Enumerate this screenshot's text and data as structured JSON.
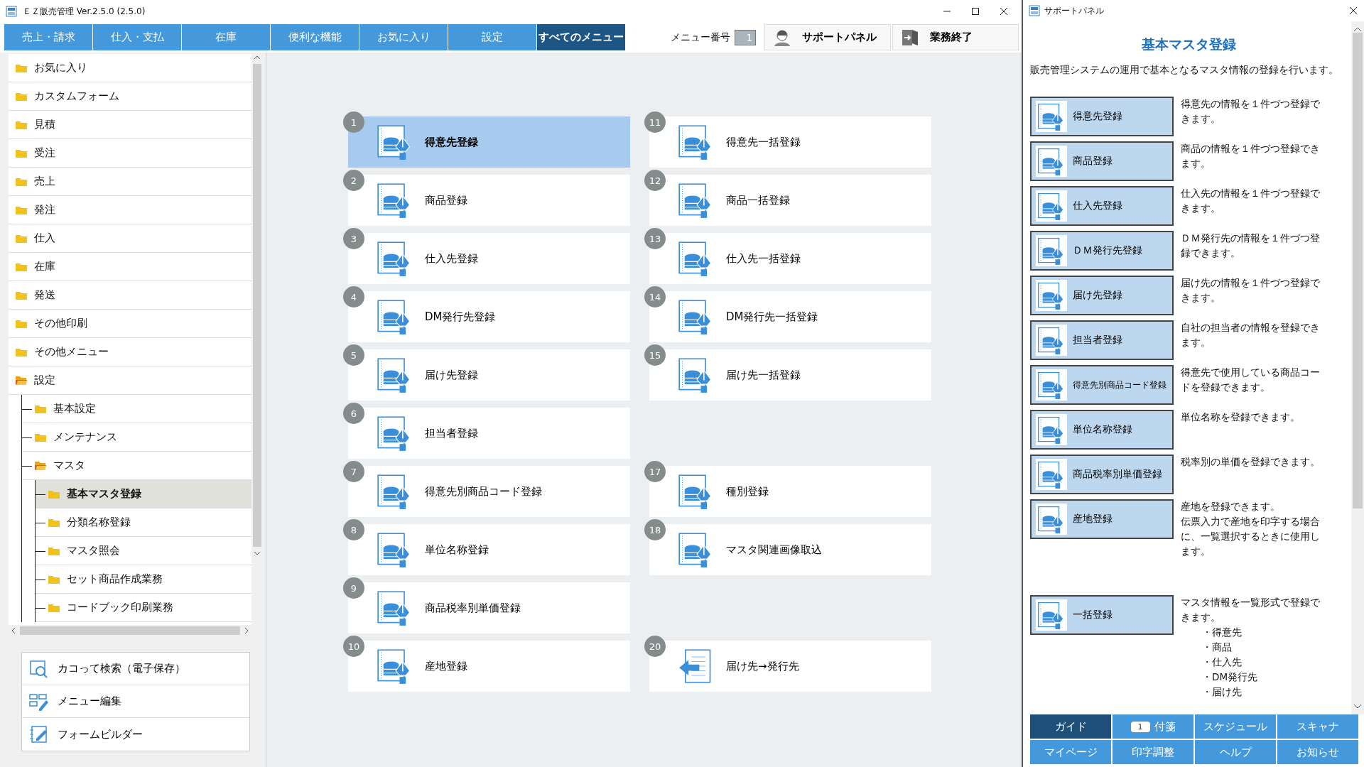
{
  "window": {
    "title": "ＥＺ販売管理 Ver.2.5.0 (2.5.0)"
  },
  "menu_tabs": [
    {
      "label": "売上・請求",
      "selected": false
    },
    {
      "label": "仕入・支払",
      "selected": false
    },
    {
      "label": "在庫",
      "selected": false
    },
    {
      "label": "便利な機能",
      "selected": false
    },
    {
      "label": "お気に入り",
      "selected": false
    },
    {
      "label": "設定",
      "selected": false
    },
    {
      "label": "すべてのメニュー",
      "selected": true
    }
  ],
  "menu_number": {
    "label": "メニュー番号",
    "value": "1"
  },
  "toolbar_buttons": [
    {
      "label": "サポートパネル",
      "kind": "support"
    },
    {
      "label": "業務終了",
      "kind": "exit"
    }
  ],
  "tree": [
    {
      "label": "お気に入り",
      "expanded": false,
      "selected": false
    },
    {
      "label": "カスタムフォーム",
      "expanded": false,
      "selected": false
    },
    {
      "label": "見積",
      "expanded": false,
      "selected": false
    },
    {
      "label": "受注",
      "expanded": false,
      "selected": false
    },
    {
      "label": "売上",
      "expanded": false,
      "selected": false
    },
    {
      "label": "発注",
      "expanded": false,
      "selected": false
    },
    {
      "label": "仕入",
      "expanded": false,
      "selected": false
    },
    {
      "label": "在庫",
      "expanded": false,
      "selected": false
    },
    {
      "label": "発送",
      "expanded": false,
      "selected": false
    },
    {
      "label": "その他印刷",
      "expanded": false,
      "selected": false
    },
    {
      "label": "その他メニュー",
      "expanded": false,
      "selected": false
    },
    {
      "label": "設定",
      "expanded": true,
      "selected": false,
      "children": [
        {
          "label": "基本設定",
          "expanded": false,
          "selected": false
        },
        {
          "label": "メンテナンス",
          "expanded": false,
          "selected": false
        },
        {
          "label": "マスタ",
          "expanded": true,
          "selected": false,
          "children": [
            {
              "label": "基本マスタ登録",
              "expanded": false,
              "selected": true
            },
            {
              "label": "分類名称登録",
              "expanded": false,
              "selected": false
            },
            {
              "label": "マスタ照会",
              "expanded": false,
              "selected": false
            },
            {
              "label": "セット商品作成業務",
              "expanded": false,
              "selected": false
            },
            {
              "label": "コードブック印刷業務",
              "expanded": false,
              "selected": false
            }
          ]
        }
      ]
    }
  ],
  "sidebar_buttons": [
    {
      "label": "カコって検索（電子保存）",
      "kind": "search"
    },
    {
      "label": "メニュー編集",
      "kind": "edit"
    },
    {
      "label": "フォームビルダー",
      "kind": "form"
    }
  ],
  "tiles_left": [
    {
      "number": "1",
      "label": "得意先登録",
      "kind": "master",
      "selected": true
    },
    {
      "number": "2",
      "label": "商品登録",
      "kind": "master",
      "selected": false
    },
    {
      "number": "3",
      "label": "仕入先登録",
      "kind": "master",
      "selected": false
    },
    {
      "number": "4",
      "label": "DM発行先登録",
      "kind": "master",
      "selected": false
    },
    {
      "number": "5",
      "label": "届け先登録",
      "kind": "master",
      "selected": false
    },
    {
      "number": "6",
      "label": "担当者登録",
      "kind": "master",
      "selected": false
    },
    {
      "number": "7",
      "label": "得意先別商品コード登録",
      "kind": "master",
      "selected": false
    },
    {
      "number": "8",
      "label": "単位名称登録",
      "kind": "master",
      "selected": false
    },
    {
      "number": "9",
      "label": "商品税率別単価登録",
      "kind": "master",
      "selected": false
    },
    {
      "number": "10",
      "label": "産地登録",
      "kind": "master",
      "selected": false
    }
  ],
  "tiles_right": [
    {
      "number": "11",
      "label": "得意先一括登録",
      "kind": "master",
      "selected": false
    },
    {
      "number": "12",
      "label": "商品一括登録",
      "kind": "master",
      "selected": false
    },
    {
      "number": "13",
      "label": "仕入先一括登録",
      "kind": "master",
      "selected": false
    },
    {
      "number": "14",
      "label": "DM発行先一括登録",
      "kind": "master",
      "selected": false
    },
    {
      "number": "15",
      "label": "届け先一括登録",
      "kind": "master",
      "selected": false
    },
    {
      "kind": "blank"
    },
    {
      "number": "17",
      "label": "種別登録",
      "kind": "master",
      "selected": false
    },
    {
      "number": "18",
      "label": "マスタ関連画像取込",
      "kind": "master",
      "selected": false
    },
    {
      "kind": "blank"
    },
    {
      "number": "20",
      "label": "届け先→発行先",
      "kind": "transfer",
      "selected": false
    }
  ],
  "support_panel": {
    "title": "サポートパネル",
    "heading": "基本マスタ登録",
    "description": "販売管理システムの運用で基本となるマスタ情報の登録を行います。",
    "items": [
      {
        "label": "得意先登録",
        "lines": [
          "得意先の情報を１件づつ登録できます。"
        ]
      },
      {
        "label": "商品登録",
        "lines": [
          "商品の情報を１件づつ登録できます。"
        ]
      },
      {
        "label": "仕入先登録",
        "lines": [
          "仕入先の情報を１件づつ登録できます。"
        ]
      },
      {
        "label": "ＤＭ発行先登録",
        "lines": [
          "ＤＭ発行先の情報を１件づつ登録できます。"
        ]
      },
      {
        "label": "届け先登録",
        "lines": [
          "届け先の情報を１件づつ登録できます。"
        ]
      },
      {
        "label": "担当者登録",
        "lines": [
          "自社の担当者の情報を登録できます。"
        ]
      },
      {
        "label": "得意先別商品コード登録",
        "lines": [
          "得意先で使用している商品コードを登録できます。"
        ]
      },
      {
        "label": "単位名称登録",
        "lines": [
          "単位名称を登録できます。"
        ]
      },
      {
        "label": "商品税率別単価登録",
        "lines": [
          "税率別の単価を登録できます。"
        ]
      },
      {
        "label": "産地登録",
        "lines": [
          "産地を登録できます。",
          "伝票入力で産地を印字する場合に、一覧選択するときに使用します。"
        ]
      },
      {
        "label": "一括登録",
        "lines": [
          "マスタ情報を一覧形式で登録できます。"
        ],
        "bullets": [
          "・得意先",
          "・商品",
          "・仕入先",
          "・DM発行先",
          "・届け先"
        ]
      }
    ],
    "tabs": [
      {
        "label": "ガイド",
        "selected": true
      },
      {
        "label": "付箋",
        "selected": false,
        "badge": "1"
      },
      {
        "label": "スケジュール",
        "selected": false
      },
      {
        "label": "スキャナ",
        "selected": false
      },
      {
        "label": "マイページ",
        "selected": false
      },
      {
        "label": "印字調整",
        "selected": false
      },
      {
        "label": "ヘルプ",
        "selected": false
      },
      {
        "label": "お知らせ",
        "selected": false
      }
    ]
  }
}
